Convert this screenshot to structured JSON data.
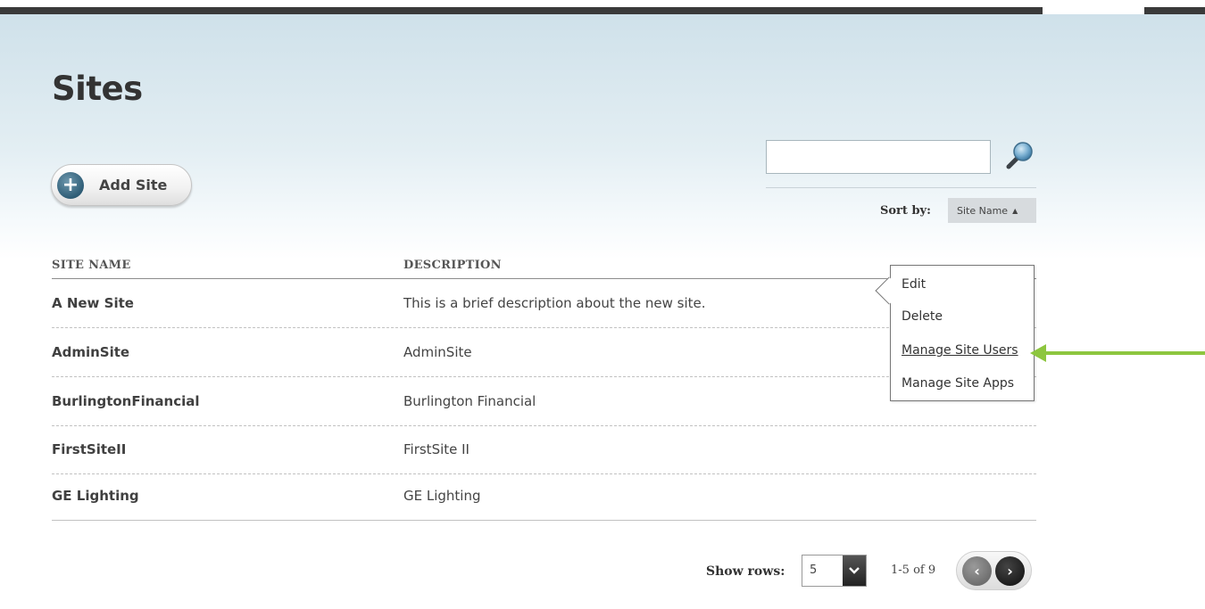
{
  "page": {
    "title": "Sites"
  },
  "toolbar": {
    "add_label": "Add Site",
    "search_value": "",
    "sort_label": "Sort by:",
    "sort_value": "Site Name",
    "sort_caret": "▲"
  },
  "table": {
    "columns": [
      "SITE NAME",
      "DESCRIPTION"
    ],
    "rows": [
      {
        "name": "A New Site",
        "description": "This is a brief description about the new site."
      },
      {
        "name": "AdminSite",
        "description": "AdminSite"
      },
      {
        "name": "BurlingtonFinancial",
        "description": "Burlington Financial"
      },
      {
        "name": "FirstSiteII",
        "description": "FirstSite II"
      },
      {
        "name": "GE Lighting",
        "description": "GE Lighting"
      }
    ]
  },
  "context_menu": {
    "items": [
      "Edit",
      "Delete",
      "Manage Site Users",
      "Manage Site Apps"
    ],
    "highlighted": "Manage Site Users"
  },
  "pagination": {
    "show_rows_label": "Show rows:",
    "rows_value": "5",
    "range_text": "1-5 of 9",
    "prev_glyph": "‹",
    "next_glyph": "›"
  },
  "colors": {
    "accent_arrow": "#8dc63f",
    "header_band": "#d5e6ee",
    "topbar": "#3a3a3a"
  },
  "icons": {
    "add": "plus-circle-icon",
    "search": "magnifier-icon",
    "dropdown": "chevron-down-icon",
    "prev": "chevron-left-icon",
    "next": "chevron-right-icon",
    "callout": "arrow-left-icon"
  }
}
